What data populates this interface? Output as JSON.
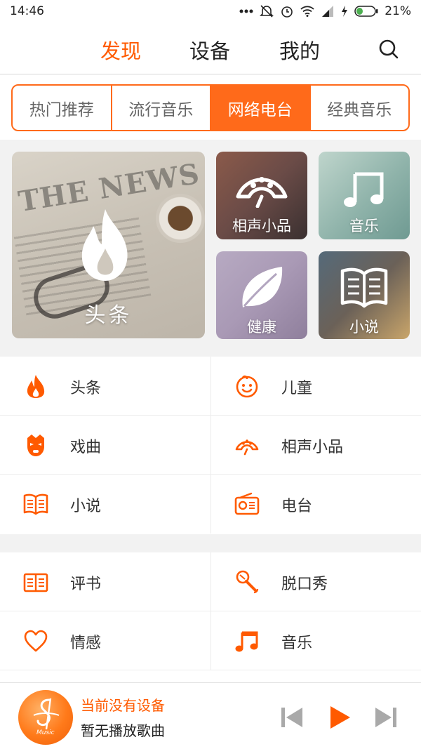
{
  "status_bar": {
    "time": "14:46",
    "battery": "21%",
    "icons": [
      "dots-icon",
      "mute-icon",
      "alarm-icon",
      "wifi-icon",
      "signal-icon",
      "charging-icon",
      "battery-icon"
    ]
  },
  "header": {
    "tabs": [
      {
        "label": "发现",
        "active": true
      },
      {
        "label": "设备",
        "active": false
      },
      {
        "label": "我的",
        "active": false
      }
    ],
    "search_icon": "search-icon"
  },
  "segments": [
    {
      "label": "热门推荐",
      "active": false
    },
    {
      "label": "流行音乐",
      "active": false
    },
    {
      "label": "网络电台",
      "active": true
    },
    {
      "label": "经典音乐",
      "active": false
    }
  ],
  "banners": {
    "news": {
      "label": "头条",
      "bg_text": "THE NEWS",
      "icon": "flame-icon"
    },
    "tiles": [
      {
        "label": "相声小品",
        "icon": "fan-icon"
      },
      {
        "label": "音乐",
        "icon": "music-note-icon"
      },
      {
        "label": "健康",
        "icon": "leaf-icon"
      },
      {
        "label": "小说",
        "icon": "book-icon"
      }
    ]
  },
  "categories_group1": [
    {
      "label": "头条",
      "icon": "flame-icon"
    },
    {
      "label": "儿童",
      "icon": "child-face-icon"
    },
    {
      "label": "戏曲",
      "icon": "opera-mask-icon"
    },
    {
      "label": "相声小品",
      "icon": "fan-icon"
    },
    {
      "label": "小说",
      "icon": "book-icon"
    },
    {
      "label": "电台",
      "icon": "radio-icon"
    }
  ],
  "categories_group2": [
    {
      "label": "评书",
      "icon": "open-book-icon"
    },
    {
      "label": "脱口秀",
      "icon": "microphone-icon"
    },
    {
      "label": "情感",
      "icon": "heart-icon"
    },
    {
      "label": "音乐",
      "icon": "music-note-icon"
    }
  ],
  "player": {
    "title": "当前没有设备",
    "subtitle": "暂无播放歌曲",
    "album_text": "Music",
    "controls": [
      "previous-icon",
      "play-icon",
      "next-icon"
    ]
  },
  "colors": {
    "accent": "#ff5a00",
    "segment_active_bg": "#ff6a1a",
    "text": "#333333",
    "divider": "#ececec"
  }
}
